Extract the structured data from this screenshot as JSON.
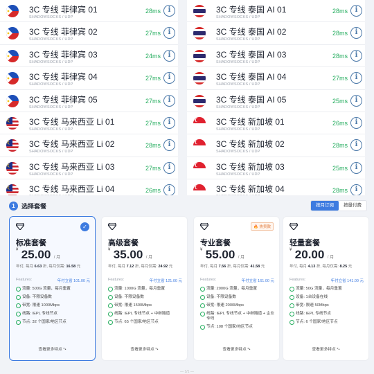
{
  "servers_left": [
    {
      "name": "3C 专线 菲律宾 01",
      "protocol": "SHADOWSOCKS / UDP",
      "latency": "28ms",
      "flag": "ph"
    },
    {
      "name": "3C 专线 菲律宾 02",
      "protocol": "SHADOWSOCKS / UDP",
      "latency": "27ms",
      "flag": "ph"
    },
    {
      "name": "3C 专线 菲律宾 03",
      "protocol": "SHADOWSOCKS / UDP",
      "latency": "24ms",
      "flag": "ph"
    },
    {
      "name": "3C 专线 菲律宾 04",
      "protocol": "SHADOWSOCKS / UDP",
      "latency": "27ms",
      "flag": "ph"
    },
    {
      "name": "3C 专线 菲律宾 05",
      "protocol": "SHADOWSOCKS / UDP",
      "latency": "27ms",
      "flag": "ph"
    },
    {
      "name": "3C 专线 马来西亚 Li 01",
      "protocol": "SHADOWSOCKS / UDP",
      "latency": "27ms",
      "flag": "my"
    },
    {
      "name": "3C 专线 马来西亚 Li 02",
      "protocol": "SHADOWSOCKS / UDP",
      "latency": "28ms",
      "flag": "my"
    },
    {
      "name": "3C 专线 马来西亚 Li 03",
      "protocol": "SHADOWSOCKS / UDP",
      "latency": "27ms",
      "flag": "my"
    },
    {
      "name": "3C 专线 马来西亚 Li 04",
      "protocol": "SHADOWSOCKS / UDP",
      "latency": "26ms",
      "flag": "my"
    }
  ],
  "servers_right": [
    {
      "name": "3C 专线 泰国 AI 01",
      "protocol": "SHADOWSOCKS / UDP",
      "latency": "28ms",
      "flag": "th"
    },
    {
      "name": "3C 专线 泰国 AI 02",
      "protocol": "SHADOWSOCKS / UDP",
      "latency": "28ms",
      "flag": "th"
    },
    {
      "name": "3C 专线 泰国 AI 03",
      "protocol": "SHADOWSOCKS / UDP",
      "latency": "28ms",
      "flag": "th"
    },
    {
      "name": "3C 专线 泰国 AI 04",
      "protocol": "SHADOWSOCKS / UDP",
      "latency": "27ms",
      "flag": "th"
    },
    {
      "name": "3C 专线 泰国 AI 05",
      "protocol": "SHADOWSOCKS / UDP",
      "latency": "25ms",
      "flag": "th"
    },
    {
      "name": "3C 专线 新加坡 01",
      "protocol": "SHADOWSOCKS / UDP",
      "latency": "26ms",
      "flag": "sg"
    },
    {
      "name": "3C 专线 新加坡 02",
      "protocol": "SHADOWSOCKS / UDP",
      "latency": "28ms",
      "flag": "sg"
    },
    {
      "name": "3C 专线 新加坡 03",
      "protocol": "SHADOWSOCKS / UDP",
      "latency": "25ms",
      "flag": "sg"
    },
    {
      "name": "3C 专线 新加坡 04",
      "protocol": "SHADOWSOCKS / UDP",
      "latency": "28ms",
      "flag": "sg"
    }
  ],
  "section": {
    "step": "1",
    "title": "选择套餐",
    "billing_monthly": "按月订阅",
    "billing_usage": "按量付费"
  },
  "plans": [
    {
      "name": "标准套餐",
      "currency": "¥",
      "price": "25.00",
      "unit": "/ 月",
      "yearly_prefix": "年付, 每月",
      "yearly_monthly": "6.63",
      "yearly_mid": "折, 每月仅需:",
      "yearly_total": "16.58",
      "yearly_suffix": "元",
      "features_label": "Features:",
      "yearly_price": "年付立省 101.00 元",
      "badge": "",
      "more": "查看更多特点 *•",
      "features": [
        "流量: 500G 流量，每月重置",
        "设备: 不限设备数",
        "带宽: 限速 1000Mbps",
        "线路: IEPL 专线节点",
        "节点: 32 个国家/地区节点"
      ]
    },
    {
      "name": "高级套餐",
      "currency": "¥",
      "price": "35.00",
      "unit": "/ 月",
      "yearly_prefix": "年付, 每月",
      "yearly_monthly": "7.12",
      "yearly_mid": "折, 每月仅需:",
      "yearly_total": "24.92",
      "yearly_suffix": "元",
      "features_label": "Features:",
      "yearly_price": "年付立省 121.00 元",
      "badge": "",
      "more": "查看更多特点 *•",
      "features": [
        "流量: 1000G 流量，每月重置",
        "设备: 不限设备数",
        "带宽: 限速 1500Mbps",
        "线路: IEPL 专线节点 + 中继隧道",
        "节点: 65 个国家/地区节点"
      ]
    },
    {
      "name": "专业套餐",
      "currency": "¥",
      "price": "55.00",
      "unit": "/ 月",
      "yearly_prefix": "年付, 每月",
      "yearly_monthly": "7.56",
      "yearly_mid": "折, 每月仅需:",
      "yearly_total": "41.58",
      "yearly_suffix": "元",
      "features_label": "Features:",
      "yearly_price": "年付立省 161.00 元",
      "badge": "🔥 热卖款",
      "more": "查看更多特点 *•",
      "features": [
        "流量: 2000G 流量，每月重置",
        "设备: 不限设备数",
        "带宽: 限速 2000Mbps",
        "线路: IEPL 专线节点 + 中继隧道 + 企业专线",
        "节点: 108 个国家/地区节点"
      ]
    },
    {
      "name": "轻量套餐",
      "currency": "¥",
      "price": "20.00",
      "unit": "/ 月",
      "yearly_prefix": "年付, 每月",
      "yearly_monthly": "4.13",
      "yearly_mid": "折, 每月仅需:",
      "yearly_total": "8.25",
      "yearly_suffix": "元",
      "features_label": "Features:",
      "yearly_price": "年付立省 141.00 元",
      "badge": "",
      "more": "查看更多特点 *•",
      "features": [
        "流量: 50G 流量，每月重置",
        "设备: 1台设备在线",
        "带宽: 限速 50Mbps",
        "线路: IEPL 专线节点",
        "节点: 6 个国家/地区节点"
      ]
    }
  ],
  "footer_text": "— 1/1 —",
  "colors": {
    "accent": "#3d7be0",
    "latency": "#27ae60",
    "info": "#4a78a8"
  }
}
